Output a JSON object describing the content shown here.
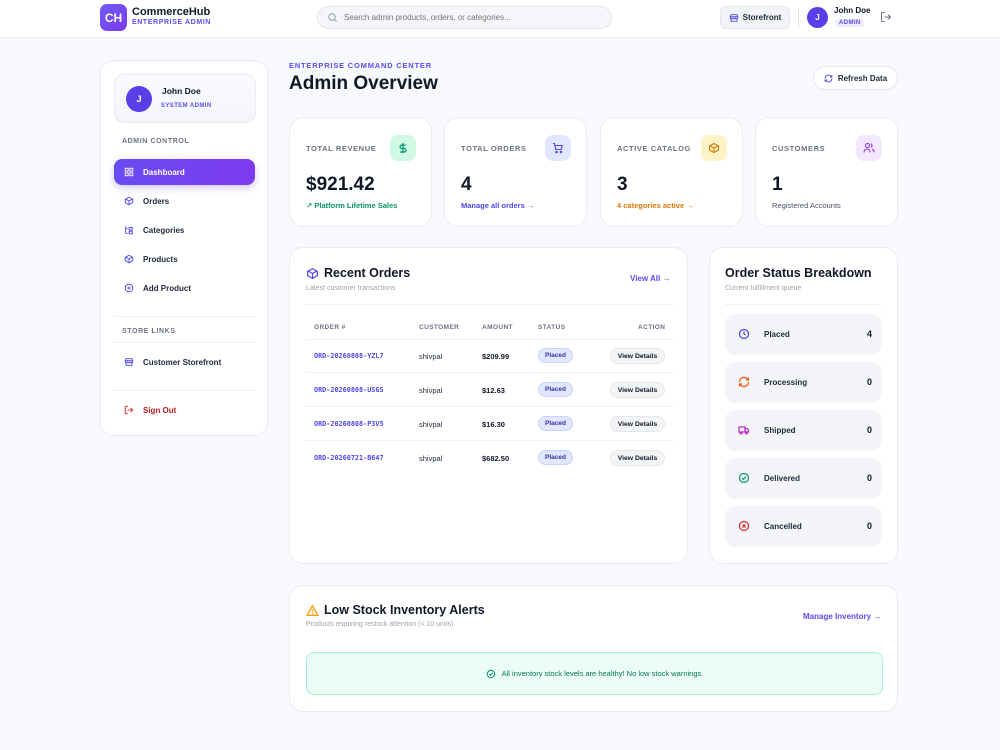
{
  "brand": {
    "logo": "CH",
    "name": "CommerceHub",
    "subtitle": "ENTERPRISE ADMIN"
  },
  "search": {
    "placeholder": "Search admin products, orders, or categories..."
  },
  "topbar": {
    "storefront_label": "Storefront",
    "avatar_initial": "J",
    "user_name": "John Doe",
    "user_role": "ADMIN"
  },
  "sidebar": {
    "profile": {
      "initial": "J",
      "name": "John Doe",
      "role": "SYSTEM ADMIN"
    },
    "admin_section": "ADMIN CONTROL",
    "items": [
      {
        "label": "Dashboard",
        "icon": "grid-icon",
        "active": true
      },
      {
        "label": "Orders",
        "icon": "box-icon"
      },
      {
        "label": "Categories",
        "icon": "tree-icon"
      },
      {
        "label": "Products",
        "icon": "cube-icon"
      },
      {
        "label": "Add Product",
        "icon": "plus-circle-icon"
      }
    ],
    "store_section": "STORE LINKS",
    "store_items": [
      {
        "label": "Customer Storefront",
        "icon": "store-icon"
      }
    ],
    "signout_label": "Sign Out"
  },
  "header": {
    "eyebrow": "ENTERPRISE COMMAND CENTER",
    "title": "Admin Overview",
    "refresh_label": "Refresh Data"
  },
  "stats": [
    {
      "label": "TOTAL REVENUE",
      "value": "$921.42",
      "sub": "↗ Platform Lifetime Sales",
      "sub_color": "#059669",
      "icon": "dollar-icon",
      "icon_bg": "#d1fae5",
      "icon_color": "#059669"
    },
    {
      "label": "TOTAL ORDERS",
      "value": "4",
      "sub": "Manage all orders →",
      "sub_color": "#4f46e5",
      "icon": "cart-icon",
      "icon_bg": "#e0e7ff",
      "icon_color": "#4f46e5"
    },
    {
      "label": "ACTIVE CATALOG",
      "value": "3",
      "sub": "4 categories active →",
      "sub_color": "#d97706",
      "icon": "package-icon",
      "icon_bg": "#fef3c7",
      "icon_color": "#d97706"
    },
    {
      "label": "CUSTOMERS",
      "value": "1",
      "sub": "Registered Accounts",
      "sub_color": "#4b5563",
      "icon": "users-icon",
      "icon_bg": "#f3e8ff",
      "icon_color": "#9333ea"
    }
  ],
  "recent_orders": {
    "title": "Recent Orders",
    "subtitle": "Latest customer transactions",
    "view_all": "View All →",
    "columns": [
      "ORDER #",
      "CUSTOMER",
      "AMOUNT",
      "STATUS",
      "ACTION"
    ],
    "rows": [
      {
        "id": "ORD-20260808-YZL7",
        "customer": "shivpal",
        "amount": "$209.99",
        "status": "Placed",
        "action": "View Details"
      },
      {
        "id": "ORD-20260808-USGS",
        "customer": "shivpal",
        "amount": "$12.63",
        "status": "Placed",
        "action": "View Details"
      },
      {
        "id": "ORD-20260808-P3V5",
        "customer": "shivpal",
        "amount": "$16.30",
        "status": "Placed",
        "action": "View Details"
      },
      {
        "id": "ORD-20260721-B647",
        "customer": "shivpal",
        "amount": "$682.50",
        "status": "Placed",
        "action": "View Details"
      }
    ]
  },
  "status_breakdown": {
    "title": "Order Status Breakdown",
    "subtitle": "Current fulfillment queue",
    "items": [
      {
        "label": "Placed",
        "count": "4",
        "icon": "clock-icon",
        "color": "#4f46e5"
      },
      {
        "label": "Processing",
        "count": "0",
        "icon": "refresh-icon",
        "color": "#ea580c"
      },
      {
        "label": "Shipped",
        "count": "0",
        "icon": "truck-icon",
        "color": "#c026d3"
      },
      {
        "label": "Delivered",
        "count": "0",
        "icon": "check-circle-icon",
        "color": "#059669"
      },
      {
        "label": "Cancelled",
        "count": "0",
        "icon": "x-circle-icon",
        "color": "#dc2626"
      }
    ]
  },
  "low_stock": {
    "title": "Low Stock Inventory Alerts",
    "subtitle": "Products requiring restock attention (< 10 units)",
    "manage_label": "Manage Inventory →",
    "healthy_message": "All inventory stock levels are healthy! No low stock warnings."
  }
}
